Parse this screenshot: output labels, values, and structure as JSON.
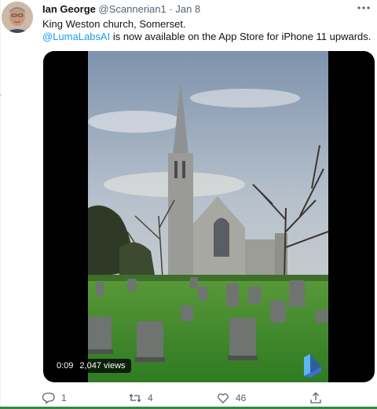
{
  "tweet": {
    "author_name": "Ian George",
    "handle": "@Scannerian1",
    "separator": "·",
    "date": "Jan 8",
    "line1": "King Weston church, Somerset.",
    "mention": "@LumaLabsAI",
    "line2_rest": " is now available on the App Store for iPhone 11 upwards."
  },
  "video": {
    "duration": "0:09",
    "views": "2,047 views"
  },
  "actions": {
    "replies": "1",
    "retweets": "4",
    "likes": "46"
  },
  "colors": {
    "link": "#1d9bf0",
    "muted": "#536471",
    "text": "#0f1419",
    "grass": "#3f8a2c",
    "sky": "#9fb0c2"
  },
  "icons": [
    "more-icon",
    "reply-icon",
    "retweet-icon",
    "like-icon",
    "share-icon",
    "luma-logo-icon"
  ]
}
